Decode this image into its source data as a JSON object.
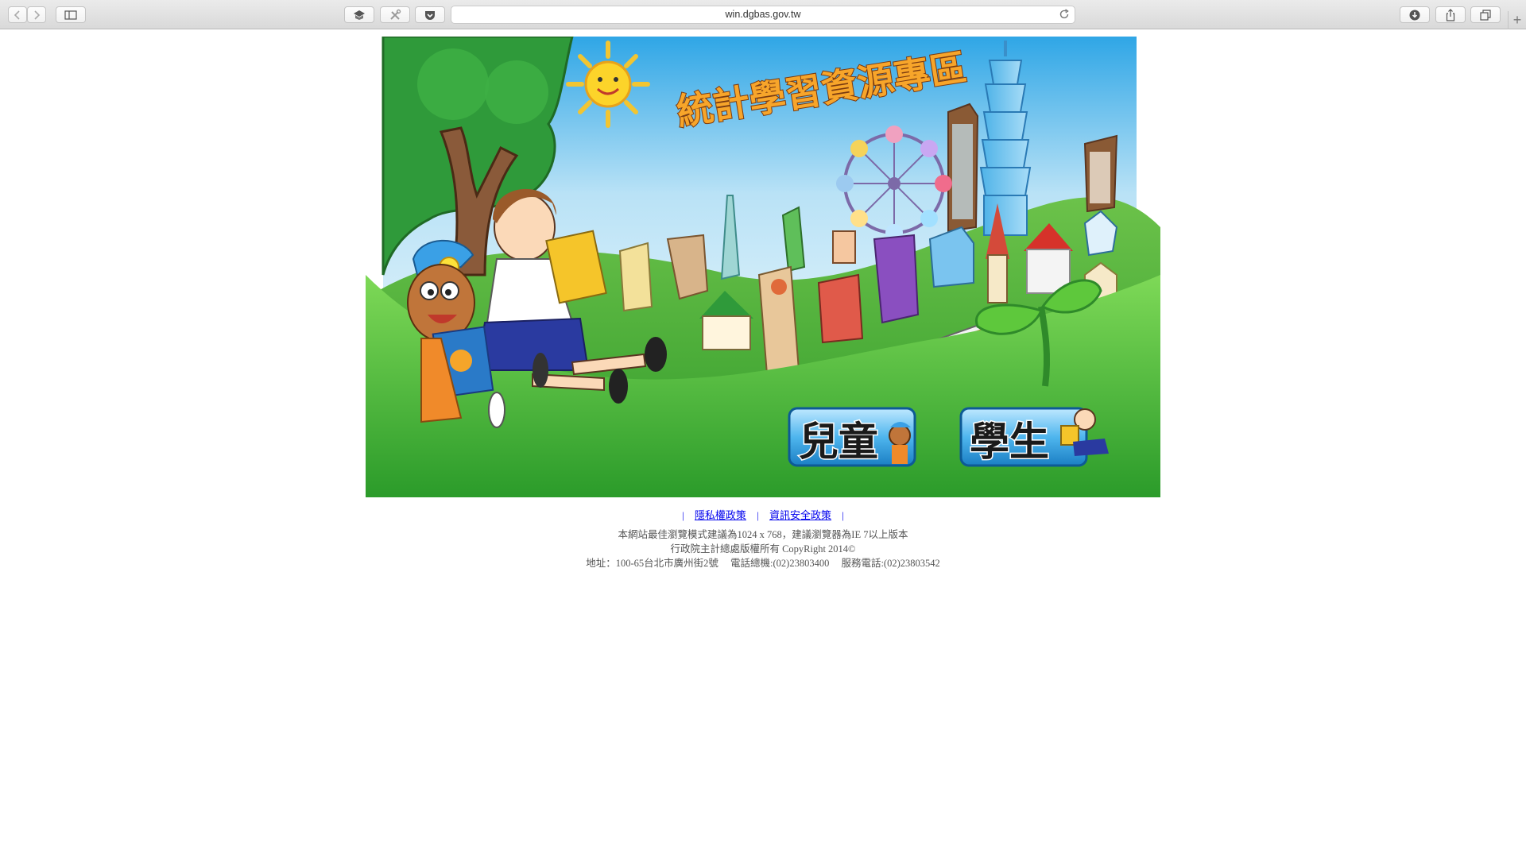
{
  "browser": {
    "url": "win.dgbas.gov.tw",
    "icons": {
      "back": "chevron-left-icon",
      "forward": "chevron-right-icon",
      "sidebar": "sidebar-icon",
      "reload": "reload-icon",
      "download": "download-icon",
      "share": "share-icon",
      "tabs": "tabs-icon",
      "new_tab": "+"
    }
  },
  "banner": {
    "title": "統計學習資源專區",
    "buttons": {
      "children": "兒童",
      "students": "學生"
    }
  },
  "footer": {
    "sep_left": "|",
    "sep_mid": "|",
    "sep_right": "|",
    "privacy_link": "隱私權政策",
    "security_link": "資訊安全政策",
    "browser_note": "本網站最佳瀏覽模式建議為1024 x 768，建議瀏覽器為IE 7以上版本",
    "copyright": "行政院主計總處版權所有 CopyRight 2014©",
    "address": "地址：100-65台北市廣州街2號",
    "phone": "電話總機:(02)23803400",
    "service_phone": "服務電話:(02)23803542"
  }
}
